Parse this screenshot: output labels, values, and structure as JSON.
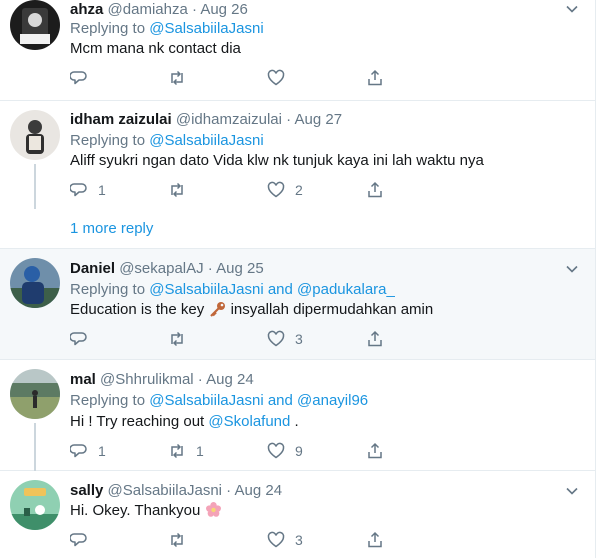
{
  "tweets": [
    {
      "name": "ahza",
      "handle": "@damiahza",
      "date": "Aug 26",
      "replying_prefix": "Replying to ",
      "replying_to": "@SalsabiilaJasni",
      "replying_and": "",
      "replying_to2": "",
      "text": "Mcm mana nk contact dia",
      "reply_count": "",
      "retweet_count": "",
      "like_count": "",
      "avatar_color": "#1c1c1c"
    },
    {
      "name": "idham zaizulai",
      "handle": "@idhamzaizulai",
      "date": "Aug 27",
      "replying_prefix": "Replying to ",
      "replying_to": "@SalsabiilaJasni",
      "replying_and": "",
      "replying_to2": "",
      "text": "Aliff syukri ngan dato Vida klw nk tunjuk kaya ini lah waktu nya",
      "reply_count": "1",
      "retweet_count": "",
      "like_count": "2",
      "avatar_color": "#e9e6e2"
    },
    {
      "name": "Daniel",
      "handle": "@sekapalAJ",
      "date": "Aug 25",
      "replying_prefix": "Replying to ",
      "replying_to": "@SalsabiilaJasni",
      "replying_and": " and ",
      "replying_to2": "@padukalara_",
      "text": "Education is the key",
      "text_after": " insyallah dipermudahkan amin",
      "reply_count": "",
      "retweet_count": "",
      "like_count": "3",
      "avatar_color": "#4a7fb0"
    },
    {
      "name": "mal",
      "handle": "@Shhrulikmal",
      "date": "Aug 24",
      "replying_prefix": "Replying to ",
      "replying_to": "@SalsabiilaJasni",
      "replying_and": " and ",
      "replying_to2": "@anayil96",
      "text": "Hi ! Try reaching out ",
      "text_link": "@Skolafund",
      "text_after": " .",
      "reply_count": "1",
      "retweet_count": "1",
      "like_count": "9",
      "avatar_color": "#5d7a63"
    },
    {
      "name": "sally",
      "handle": "@SalsabiilaJasni",
      "date": "Aug 24",
      "replying_prefix": "",
      "replying_to": "",
      "replying_and": "",
      "replying_to2": "",
      "text": "Hi. Okey. Thankyou",
      "reply_count": "",
      "retweet_count": "",
      "like_count": "3",
      "avatar_color": "#6fb59a"
    }
  ],
  "more_reply": "1 more reply",
  "separator": "·",
  "colors": {
    "link": "#1b95e0",
    "muted": "#657786",
    "border": "#e6ecf0"
  },
  "icons": [
    "reply-icon",
    "retweet-icon",
    "like-icon",
    "share-icon",
    "caret-down-icon",
    "key-emoji-icon",
    "flower-emoji-icon"
  ]
}
